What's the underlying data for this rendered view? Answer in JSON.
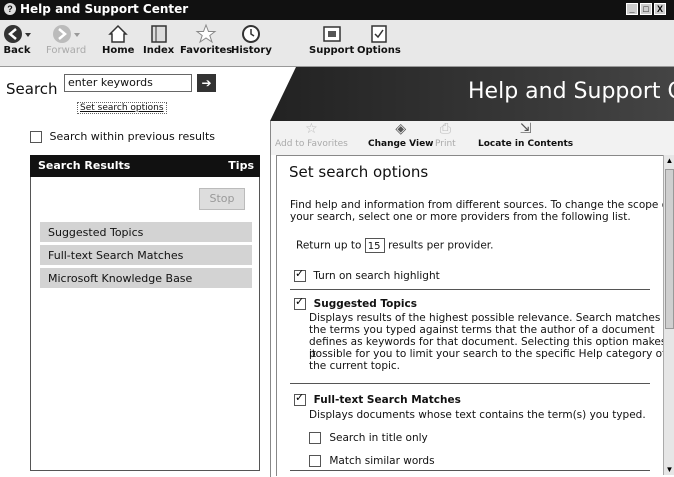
{
  "window": {
    "title": "Help and Support Center",
    "controls": [
      "_",
      "□",
      "X"
    ]
  },
  "toolbar": {
    "back": "Back",
    "forward": "Forward",
    "home": "Home",
    "index": "Index",
    "favorites": "Favorites",
    "history": "History",
    "support": "Support",
    "options": "Options"
  },
  "search": {
    "label": "Search",
    "placeholder": "enter keywords",
    "go_icon": "arrow-right",
    "set_options_link": "Set search options"
  },
  "banner": {
    "title": "Help and Support Cente"
  },
  "left": {
    "search_within": "Search within previous results",
    "results_header": "Search Results",
    "tips": "Tips",
    "stop": "Stop",
    "providers": [
      "Suggested Topics",
      "Full-text Search Matches",
      "Microsoft Knowledge Base"
    ]
  },
  "right_toolbar": {
    "add_favorites": "Add to Favorites",
    "change_view": "Change View",
    "print": "Print",
    "locate": "Locate in Contents"
  },
  "content": {
    "title": "Set search options",
    "intro_1": "Find help and information from different sources. To change the scope of",
    "intro_2": "your search, select one or more providers from the following list.",
    "return_up_to": "Return up to",
    "results_count": "15",
    "results_per_provider": "results per provider.",
    "highlight": "Turn on search highlight",
    "suggested_title": "Suggested Topics",
    "suggested_lines": [
      "Displays results of the highest possible relevance. Search matches",
      "the terms you typed against terms that the author of a document",
      "defines as keywords for that document. Selecting this option makes it",
      "possible for you to limit your search to the specific Help category of",
      "the current topic."
    ],
    "fulltext_title": "Full-text Search Matches",
    "fulltext_desc": "Displays documents whose text contains the term(s) you typed.",
    "title_only": "Search in title only",
    "similar_words": "Match similar words"
  }
}
